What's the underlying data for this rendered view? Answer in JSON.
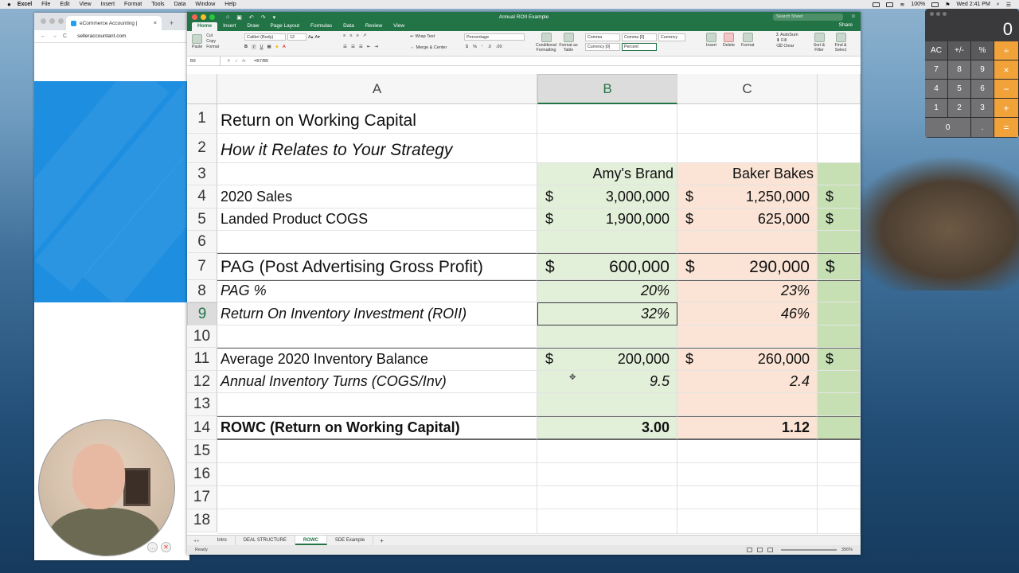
{
  "menubar": {
    "apple": "",
    "app": "Excel",
    "items": [
      "File",
      "Edit",
      "View",
      "Insert",
      "Format",
      "Tools",
      "Data",
      "Window",
      "Help"
    ],
    "battery": "100%",
    "clock": "Wed 2:41 PM"
  },
  "browser": {
    "tab_title": "eCommerce Accounting |",
    "tab_close": "×",
    "new_tab": "+",
    "back": "←",
    "forward": "→",
    "reload": "C",
    "url": "selleraccountant.com"
  },
  "excel": {
    "document_title": "Annual ROII Example",
    "search_placeholder": "Search Sheet",
    "share_label": "Share",
    "tabs": [
      "Home",
      "Insert",
      "Draw",
      "Page Layout",
      "Formulas",
      "Data",
      "Review",
      "View"
    ],
    "ribbon": {
      "paste": "Paste",
      "cut": "Cut",
      "copy": "Copy",
      "format_painter": "Format",
      "font_name": "Calibri (Body)",
      "font_size": "12",
      "bold": "B",
      "italic": "I",
      "underline": "U",
      "wrap_text": "Wrap Text",
      "merge_center": "Merge & Center",
      "number_format": "Percentage",
      "currency_symbol": "$",
      "percent_symbol": "%",
      "conditional_formatting": "Conditional Formatting",
      "format_as_table": "Format as Table",
      "styles": [
        "Comma",
        "Comma [0]",
        "Currency",
        "Currency [0]",
        "Percent"
      ],
      "insert": "Insert",
      "delete": "Delete",
      "format": "Format",
      "autosum": "AutoSum",
      "fill": "Fill",
      "clear": "Clear",
      "sort_filter": "Sort & Filter",
      "find_select": "Find & Select"
    },
    "formula_bar": {
      "name_box": "B9",
      "fx": "fx",
      "formula": "=B7/B5"
    },
    "columns": [
      "A",
      "B",
      "C"
    ],
    "rows": [
      "1",
      "2",
      "3",
      "4",
      "5",
      "6",
      "7",
      "8",
      "9",
      "10",
      "11",
      "12",
      "13",
      "14",
      "15",
      "16",
      "17",
      "18"
    ],
    "cells": {
      "a1": "Return on Working Capital",
      "a2": "How it Relates to Your Strategy",
      "b3": "Amy's Brand",
      "c3": "Baker Bakes",
      "a4": "2020 Sales",
      "b4_sym": "$",
      "b4": "3,000,000",
      "c4_sym": "$",
      "c4": "1,250,000",
      "d4_sym": "$",
      "a5": "Landed Product COGS",
      "b5_sym": "$",
      "b5": "1,900,000",
      "c5_sym": "$",
      "c5": "625,000",
      "d5_sym": "$",
      "a7": "PAG (Post Advertising Gross Profit)",
      "b7_sym": "$",
      "b7": "600,000",
      "c7_sym": "$",
      "c7": "290,000",
      "d7_sym": "$",
      "a8": "PAG %",
      "b8": "20%",
      "c8": "23%",
      "a9": "Return On Inventory Investment (ROII)",
      "b9": "32%",
      "c9": "46%",
      "a11": "Average 2020 Inventory Balance",
      "b11_sym": "$",
      "b11": "200,000",
      "c11_sym": "$",
      "c11": "260,000",
      "d11_sym": "$",
      "a12": "Annual Inventory Turns (COGS/Inv)",
      "b12": "9.5",
      "c12": "2.4",
      "a14": "ROWC (Return on Working Capital)",
      "b14": "3.00",
      "c14": "1.12"
    },
    "sheet_tabs": [
      "Intro",
      "DEAL STRUCTURE",
      "ROWC",
      "SDE Example"
    ],
    "active_sheet": "ROWC",
    "add_sheet": "+",
    "status": "Ready",
    "zoom": "356%"
  },
  "calculator": {
    "display": "0",
    "keys": [
      [
        "AC",
        "+/-",
        "%",
        "÷"
      ],
      [
        "7",
        "8",
        "9",
        "×"
      ],
      [
        "4",
        "5",
        "6",
        "−"
      ],
      [
        "1",
        "2",
        "3",
        "+"
      ],
      [
        "0",
        ".",
        "="
      ]
    ]
  },
  "colors": {
    "excel_green": "#227447",
    "fill_green": "#e2efd9",
    "fill_peach": "#fbe4d5",
    "calc_orange": "#f1a33a",
    "chrome_blue": "#1e8fe0"
  }
}
